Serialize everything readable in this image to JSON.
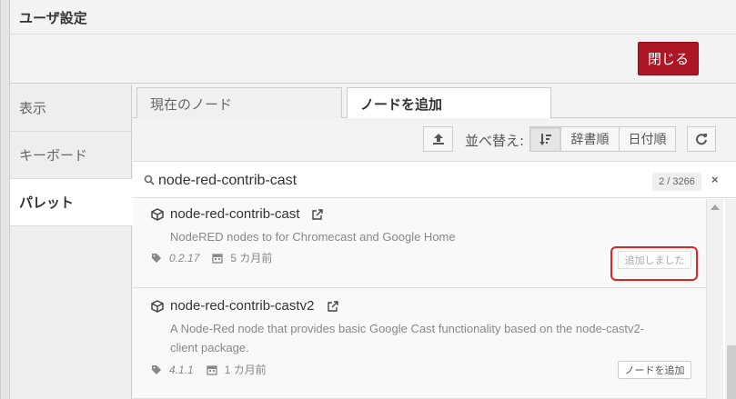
{
  "dialog": {
    "title": "ユーザ設定",
    "close_label": "閉じる",
    "accent": "#ad1625"
  },
  "sidebar": {
    "items": [
      {
        "label": "表示"
      },
      {
        "label": "キーボード"
      },
      {
        "label": "パレット"
      }
    ],
    "active": "パレット"
  },
  "tabs": [
    {
      "label": "現在のノード"
    },
    {
      "label": "ノードを追加"
    }
  ],
  "active_tab": "ノードを追加",
  "toolbar": {
    "upload_icon": "upload-icon",
    "sort_label": "並べ替え:",
    "sort_options": [
      {
        "label": "",
        "icon": "sort-relevance-icon"
      },
      {
        "label": "辞書順"
      },
      {
        "label": "日付順"
      }
    ],
    "refresh_icon": "refresh-icon"
  },
  "search": {
    "value": "node-red-contrib-cast",
    "count": "2 / 3266",
    "clear": "×"
  },
  "results": [
    {
      "name": "node-red-contrib-cast",
      "description": "NodeRED nodes to for Chromecast and Google Home",
      "version": "0.2.17",
      "updated": "5 カ月前",
      "action": "追加しました",
      "installed": true
    },
    {
      "name": "node-red-contrib-castv2",
      "description_line1": "A Node-Red node that provides basic Google Cast functionality based on the node-castv2-",
      "description_line2": "client package.",
      "version": "4.1.1",
      "updated": "1 カ月前",
      "action": "ノードを追加",
      "installed": false
    }
  ],
  "highlight_color": "#e0241f"
}
